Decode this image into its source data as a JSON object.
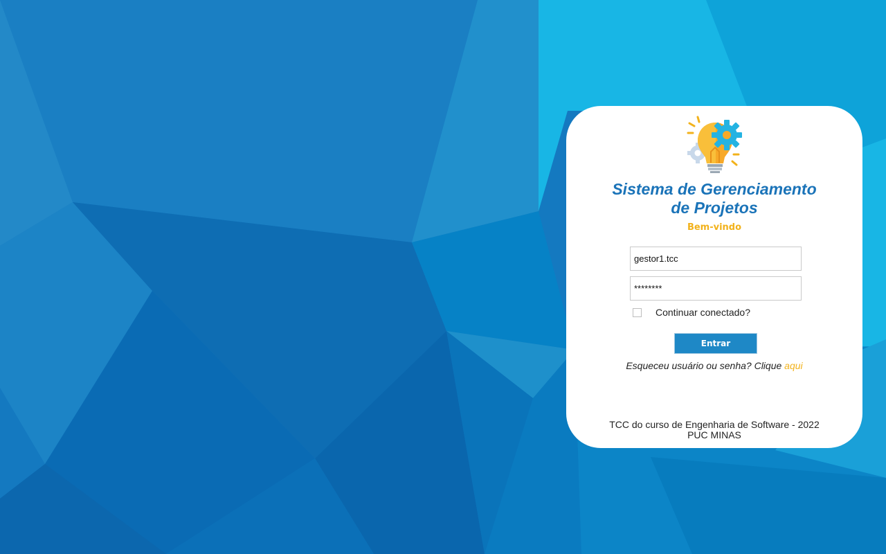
{
  "app": {
    "title_line1": "Sistema de Gerenciamento",
    "title_line2": "de Projetos",
    "welcome": "Bem-vindo"
  },
  "login": {
    "username_value": "gestor1.tcc",
    "password_value": "********",
    "remember_label": "Continuar conectado?",
    "remember_checked": false,
    "submit_label": "Entrar",
    "forgot_text": "Esqueceu usuário ou senha? Clique ",
    "forgot_link": "aqui"
  },
  "footer": {
    "line1": "TCC do curso de Engenharia de Software - 2022",
    "line2": "PUC MINAS"
  },
  "icons": {
    "logo": "lightbulb-gear-icon"
  },
  "colors": {
    "title": "#1a73b8",
    "accent": "#f2b21b",
    "button": "#1e88c6",
    "background_primary": "#1479c0",
    "background_light": "#19b8e6"
  }
}
